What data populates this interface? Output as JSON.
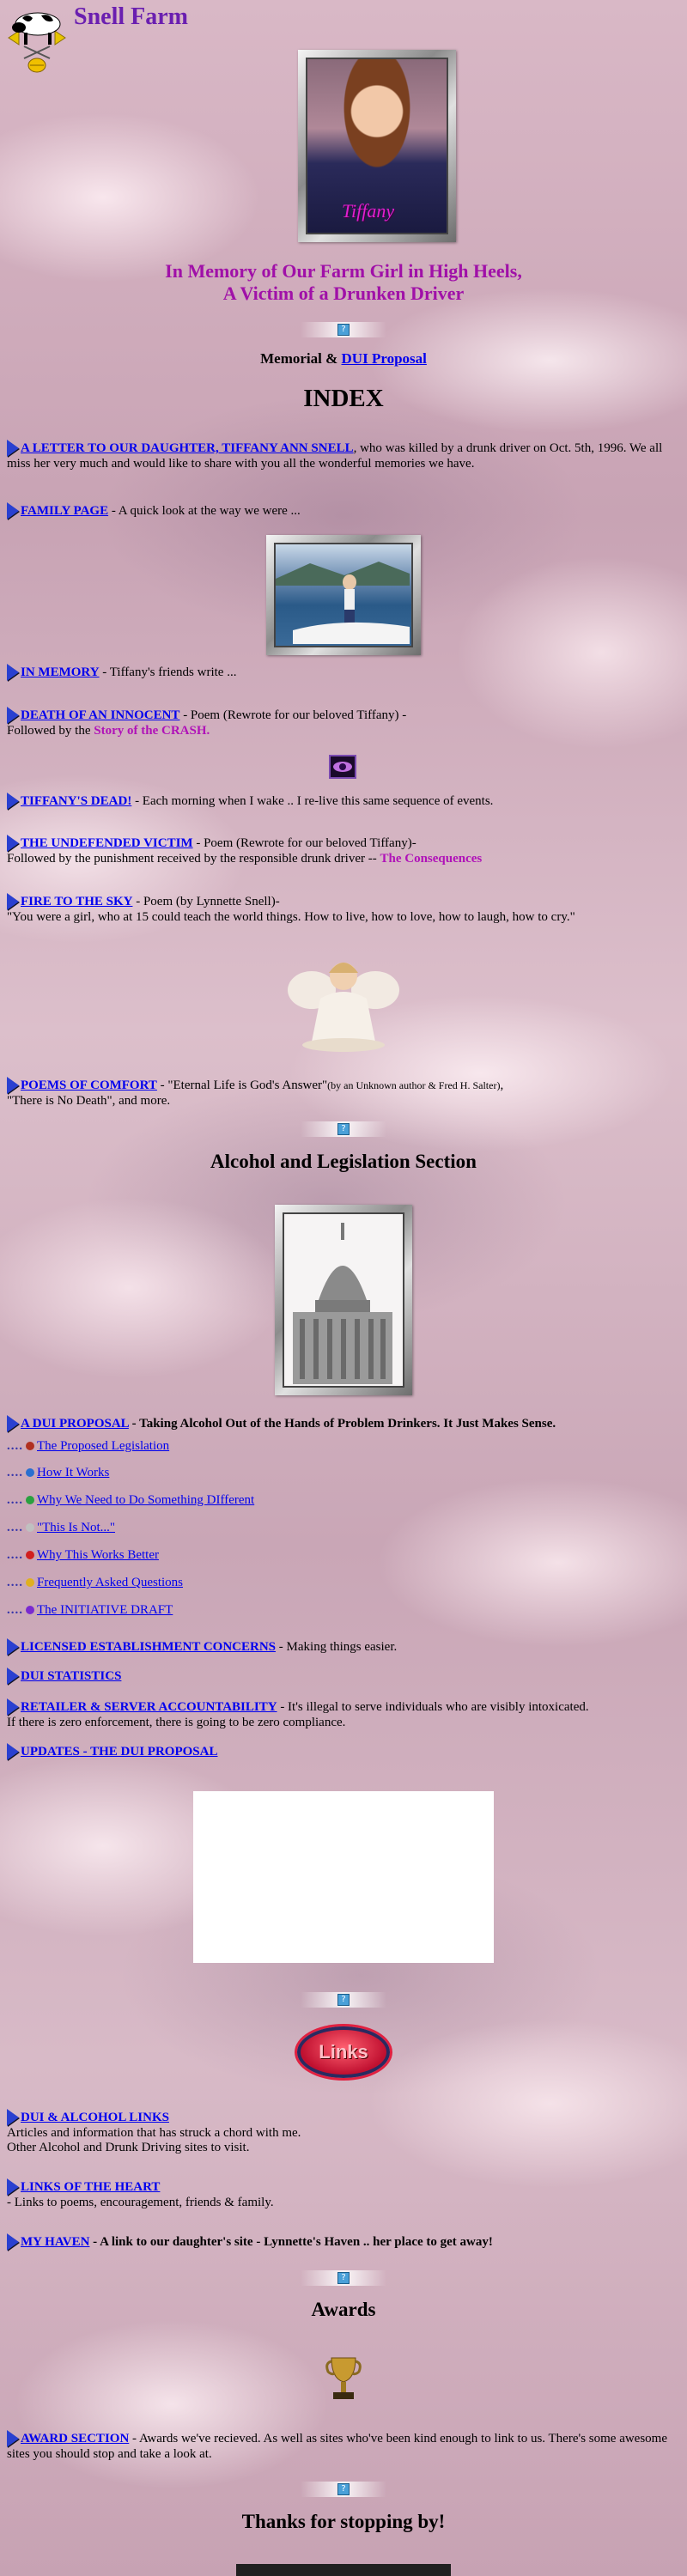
{
  "site": {
    "title": "Snell Farm"
  },
  "memorial": {
    "portrait_caption": "Tiffany",
    "heading_line1": "In Memory of Our Farm Girl in High Heels,",
    "heading_line2": "A Victim of a Drunken Driver",
    "memorial_text": "Memorial &",
    "dui_link": "DUI Proposal"
  },
  "index_heading": "INDEX",
  "entries": {
    "letter": {
      "link": "A LETTER TO OUR DAUGHTER, TIFFANY ANN SNELL",
      "text": ", who was killed by a drunk driver on Oct. 5th, 1996. We all miss her very much and would like to share with you all the wonderful memories we have."
    },
    "family": {
      "link": "FAMILY PAGE",
      "text": " - A quick look at the way we were ..."
    },
    "in_memory": {
      "link": "IN MEMORY",
      "text": " - Tiffany's friends write ..."
    },
    "death": {
      "link": "DEATH OF AN INNOCENT",
      "text": " - Poem (Rewrote for our beloved Tiffany) -",
      "line2": "Followed by the ",
      "highlight": "Story of the CRASH."
    },
    "dead": {
      "link": "TIFFANY'S DEAD!",
      "text": " - Each morning when I wake .. I re-live this same sequence of events."
    },
    "victim": {
      "link": "THE UNDEFENDED VICTIM",
      "text": " - Poem (Rewrote for our beloved Tiffany)-",
      "line2": "Followed by the punishment received by the responsible drunk driver -- ",
      "highlight": "The Consequences"
    },
    "fire": {
      "link": "FIRE TO THE SKY",
      "text": " - Poem (by Lynnette Snell)-",
      "line2": "\"You were a girl, who at 15 could teach the world things. How to live, how to love, how to laugh, how to cry.\""
    },
    "poems": {
      "link": "POEMS OF COMFORT",
      "text": " - \"Eternal Life is God's Answer\"",
      "small": "(by an Unknown author & Fred H. Salter)",
      "line2": ",",
      "line3": "\"There is No Death\", and more."
    }
  },
  "alcohol_heading": "Alcohol and Legislation Section",
  "dui": {
    "link": "A DUI PROPOSAL",
    "text": " - Taking Alcohol Out of the Hands of Problem Drinkers. It Just Makes Sense.",
    "sub_items": [
      {
        "dots": "....",
        "label": "The Proposed Legislation",
        "color": "#b03020"
      },
      {
        "dots": "....",
        "label": "How It Works",
        "color": "#2a6fd0"
      },
      {
        "dots": "....",
        "label": "Why We Need to Do Something DIfferent",
        "color": "#2aa040"
      },
      {
        "dots": "....",
        "label": "\"This Is Not...\"",
        "color": "#c0c0c0"
      },
      {
        "dots": "....",
        "label": "Why This Works Better",
        "color": "#d02020"
      },
      {
        "dots": "....",
        "label": "Frequently Asked Questions",
        "color": "#e0b020"
      },
      {
        "dots": "....",
        "label": "The INITIATIVE DRAFT",
        "color": "#7a2ad0"
      }
    ]
  },
  "legislation": {
    "licensed": {
      "link": "LICENSED ESTABLISHMENT CONCERNS",
      "text": " - Making things easier."
    },
    "stats": {
      "link": "DUI STATISTICS"
    },
    "retailer": {
      "link": "RETAILER & SERVER ACCOUNTABILITY",
      "text": " - It's illegal to serve individuals who are visibly intoxicated.",
      "line2": "If there is zero enforcement, there is going to be zero compliance."
    },
    "updates": {
      "link": "UPDATES - THE DUI PROPOSAL"
    }
  },
  "links_badge": "Links",
  "links": {
    "dui_links": {
      "link": "DUI & ALCOHOL LINKS",
      "line2": "Articles and information that has struck a chord with me.",
      "line3": "Other Alcohol and Drunk Driving sites to visit."
    },
    "heart": {
      "link": "LINKS OF THE HEART",
      "line2": "- Links to poems, encouragement, friends & family."
    },
    "haven": {
      "link": "MY HAVEN",
      "text": " - A link to our daughter's site - Lynnette's Haven .. her place to get away!"
    }
  },
  "awards_heading": "Awards",
  "award_section": {
    "link": "AWARD SECTION",
    "text": " - Awards we've recieved. As well as sites who've been kind enough to link to us. There's some awesome sites you should stop and take a look at."
  },
  "thanks": "Thanks for stopping by!"
}
